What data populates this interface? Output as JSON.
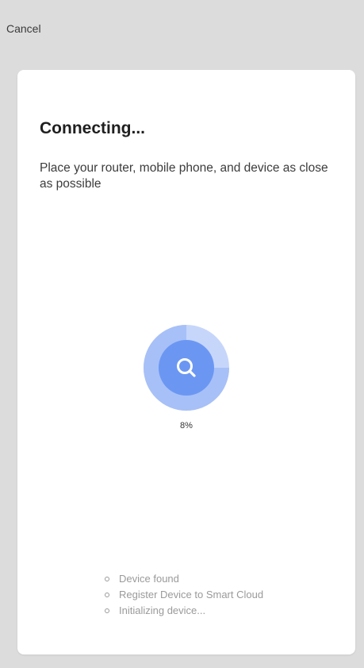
{
  "header": {
    "cancel_label": "Cancel"
  },
  "card": {
    "title": "Connecting...",
    "subtitle": "Place your router, mobile phone, and device as close as possible"
  },
  "progress": {
    "value": 0.08,
    "label": "8%",
    "icon": "search-icon",
    "colors": {
      "outer_ring": "#c6d6fb",
      "progress_ring": "#a7c0f7",
      "inner_circle": "#6b97f3"
    }
  },
  "steps": [
    "Device found",
    "Register Device to Smart Cloud",
    "Initializing device..."
  ]
}
